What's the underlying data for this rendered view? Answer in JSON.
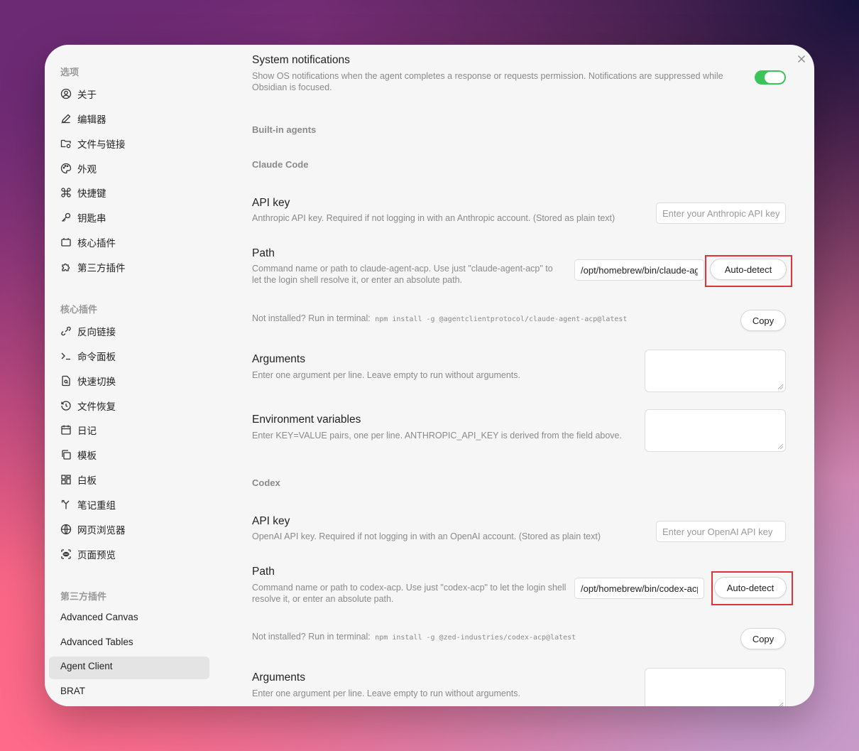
{
  "sidebar": {
    "options_header": "选项",
    "options": [
      {
        "label": "关于",
        "icon": "user-circle-icon"
      },
      {
        "label": "编辑器",
        "icon": "pencil-icon"
      },
      {
        "label": "文件与链接",
        "icon": "folder-cog-icon"
      },
      {
        "label": "外观",
        "icon": "palette-icon"
      },
      {
        "label": "快捷键",
        "icon": "command-icon"
      },
      {
        "label": "钥匙串",
        "icon": "key-icon"
      },
      {
        "label": "核心插件",
        "icon": "plug-icon"
      },
      {
        "label": "第三方插件",
        "icon": "puzzle-icon"
      }
    ],
    "core_header": "核心插件",
    "core": [
      {
        "label": "反向链接",
        "icon": "backlink-icon"
      },
      {
        "label": "命令面板",
        "icon": "terminal-icon"
      },
      {
        "label": "快速切换",
        "icon": "file-search-icon"
      },
      {
        "label": "文件恢复",
        "icon": "history-icon"
      },
      {
        "label": "日记",
        "icon": "calendar-icon"
      },
      {
        "label": "模板",
        "icon": "copy-icon"
      },
      {
        "label": "白板",
        "icon": "layout-icon"
      },
      {
        "label": "笔记重组",
        "icon": "merge-icon"
      },
      {
        "label": "网页浏览器",
        "icon": "globe-icon"
      },
      {
        "label": "页面预览",
        "icon": "scan-eye-icon"
      }
    ],
    "third_header": "第三方插件",
    "third": [
      "Advanced Canvas",
      "Advanced Tables",
      "Agent Client",
      "BRAT"
    ],
    "active": "Agent Client"
  },
  "notifications": {
    "title": "System notifications",
    "desc": "Show OS notifications when the agent completes a response or requests permission. Notifications are suppressed while Obsidian is focused.",
    "enabled": true
  },
  "builtin_header": "Built-in agents",
  "claude": {
    "header": "Claude Code",
    "api_key_title": "API key",
    "api_key_desc": "Anthropic API key. Required if not logging in with an Anthropic account. (Stored as plain text)",
    "api_key_placeholder": "Enter your Anthropic API key",
    "path_title": "Path",
    "path_desc": "Command name or path to claude-agent-acp. Use just \"claude-agent-acp\" to let the login shell resolve it, or enter an absolute path.",
    "path_value": "/opt/homebrew/bin/claude-agent-acp",
    "autodetect_label": "Auto-detect",
    "install_prefix": "Not installed? Run in terminal:",
    "install_cmd": "npm install -g @agentclientprotocol/claude-agent-acp@latest",
    "copy_label": "Copy",
    "args_title": "Arguments",
    "args_desc": "Enter one argument per line. Leave empty to run without arguments.",
    "env_title": "Environment variables",
    "env_desc": "Enter KEY=VALUE pairs, one per line. ANTHROPIC_API_KEY is derived from the field above."
  },
  "codex": {
    "header": "Codex",
    "api_key_title": "API key",
    "api_key_desc": "OpenAI API key. Required if not logging in with an OpenAI account. (Stored as plain text)",
    "api_key_placeholder": "Enter your OpenAI API key",
    "path_title": "Path",
    "path_desc": "Command name or path to codex-acp. Use just \"codex-acp\" to let the login shell resolve it, or enter an absolute path.",
    "path_value": "/opt/homebrew/bin/codex-acp",
    "autodetect_label": "Auto-detect",
    "install_prefix": "Not installed? Run in terminal:",
    "install_cmd": "npm install -g @zed-industries/codex-acp@latest",
    "copy_label": "Copy",
    "args_title": "Arguments",
    "args_desc": "Enter one argument per line. Leave empty to run without arguments."
  },
  "colors": {
    "accent_toggle": "#3ac45a",
    "highlight": "#e1343a"
  }
}
